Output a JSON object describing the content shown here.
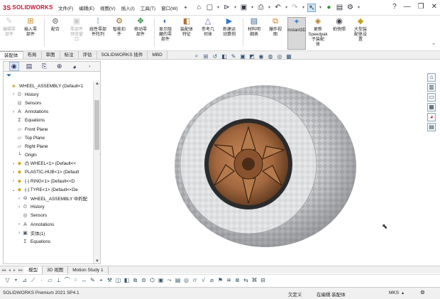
{
  "app": {
    "brand_ds": "3S",
    "brand_name": "SOLIDWORKS"
  },
  "menu": [
    "文件(F)",
    "编辑(E)",
    "视图(V)",
    "插入(I)",
    "工具(T)",
    "窗口(W)"
  ],
  "toolbar_icons": [
    "home-icon",
    "new-file-icon",
    "open-file-icon",
    "save-icon",
    "print-icon",
    "undo-icon",
    "redo-icon",
    "select-icon",
    "rebuild-icon",
    "file-properties-icon",
    "options-icon",
    "settings-icon"
  ],
  "ribbon": [
    {
      "label": "编辑零\n部件",
      "icon": "edit-part-icon",
      "disabled": true
    },
    {
      "label": "插入零\n部件",
      "icon": "insert-component-icon",
      "disabled": false
    },
    {
      "label": "配合",
      "icon": "mate-icon",
      "disabled": false
    },
    {
      "label": "零部件\n预览窗\n口",
      "icon": "component-preview-icon",
      "disabled": true
    },
    {
      "label": "线性零部\n件阵列",
      "icon": "linear-pattern-icon",
      "disabled": false
    },
    {
      "label": "智能扣\n件",
      "icon": "smart-fastener-icon",
      "disabled": false
    },
    {
      "label": "移动零\n部件",
      "icon": "move-component-icon",
      "disabled": false
    },
    {
      "label": "显示隐\n藏的零\n部件",
      "icon": "show-hidden-icon",
      "disabled": false
    },
    {
      "label": "装配体\n特征",
      "icon": "assembly-feature-icon",
      "disabled": false
    },
    {
      "label": "参考几\n何体",
      "icon": "reference-geometry-icon",
      "disabled": false
    },
    {
      "label": "新建运\n动算例",
      "icon": "motion-study-icon",
      "disabled": false
    },
    {
      "label": "材料明\n细表",
      "icon": "bom-icon",
      "disabled": false
    },
    {
      "label": "爆炸视\n图",
      "icon": "exploded-view-icon",
      "disabled": false
    },
    {
      "label": "Instant3D",
      "icon": "instant3d-icon",
      "disabled": false,
      "active": true
    },
    {
      "label": "更新\nSpeedpak\n子装配\n体",
      "icon": "speedpak-icon",
      "disabled": false
    },
    {
      "label": "拍快照",
      "icon": "snapshot-icon",
      "disabled": false
    },
    {
      "label": "大型装\n配体设\n置",
      "icon": "large-assembly-icon",
      "disabled": false
    }
  ],
  "cmd_tabs": [
    "装配体",
    "布局",
    "草图",
    "标注",
    "评估",
    "SOLIDWORKS 插件",
    "MBD"
  ],
  "cmd_active_tab": 0,
  "feature_tree": [
    {
      "indent": 0,
      "exp": "",
      "icon": "assembly-icon",
      "text": "WHEEL_ASSEMBLY  (Default<1"
    },
    {
      "indent": 1,
      "exp": "›",
      "icon": "history-icon",
      "text": "History"
    },
    {
      "indent": 1,
      "exp": "",
      "icon": "sensor-icon",
      "text": "Sensors"
    },
    {
      "indent": 1,
      "exp": "›",
      "icon": "annotation-icon",
      "text": "Annotations"
    },
    {
      "indent": 1,
      "exp": "",
      "icon": "equation-icon",
      "text": "Equations"
    },
    {
      "indent": 1,
      "exp": "",
      "icon": "plane-icon",
      "text": "Front Plane"
    },
    {
      "indent": 1,
      "exp": "",
      "icon": "plane-icon",
      "text": "Top Plane"
    },
    {
      "indent": 1,
      "exp": "",
      "icon": "plane-icon",
      "text": "Right Plane"
    },
    {
      "indent": 1,
      "exp": "",
      "icon": "origin-icon",
      "text": "Origin"
    },
    {
      "indent": 1,
      "exp": "›",
      "icon": "part-icon",
      "text": "(f) WHEEL<1> (Default<<"
    },
    {
      "indent": 1,
      "exp": "›",
      "icon": "part-icon",
      "text": "PLASTIC-HUB<1> (Default"
    },
    {
      "indent": 1,
      "exp": "›",
      "icon": "part-icon",
      "text": "(-) RING<1> (Default<<D"
    },
    {
      "indent": 1,
      "exp": "⌄",
      "icon": "part-icon",
      "text": "(-) TYRE<1> (Default<<De"
    },
    {
      "indent": 2,
      "exp": "›",
      "icon": "mates-icon",
      "text": "WHEEL_ASSEMBLY 中的配"
    },
    {
      "indent": 2,
      "exp": "›",
      "icon": "history-icon",
      "text": "History"
    },
    {
      "indent": 2,
      "exp": "",
      "icon": "sensor-icon",
      "text": "Sensors"
    },
    {
      "indent": 2,
      "exp": "›",
      "icon": "annotation-icon",
      "text": "Annotations"
    },
    {
      "indent": 2,
      "exp": "›",
      "icon": "solid-body-icon",
      "text": "实体(1)"
    },
    {
      "indent": 2,
      "exp": "",
      "icon": "equation-icon",
      "text": "Equations"
    }
  ],
  "model_tabs": [
    "模型",
    "3D 视图",
    "Motion Study 1"
  ],
  "model_active_tab": 0,
  "status": {
    "left": "SOLIDWORKS Premium 2021 SP4.1",
    "mid1": "欠定义",
    "mid2": "在编辑 装配体",
    "units": "MKS"
  },
  "colors": {
    "accent": "#c8102e",
    "tyre": "#d8dadb",
    "rim": "#a2673e"
  }
}
